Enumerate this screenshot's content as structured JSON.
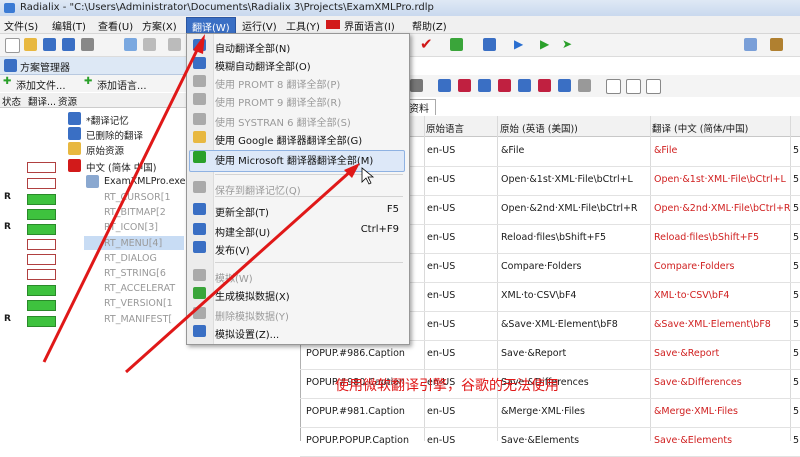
{
  "window": {
    "title": "Radialix - \"C:\\Users\\Administrator\\Documents\\Radialix 3\\Projects\\ExamXMLPro.rdlp"
  },
  "menubar": [
    {
      "label": "文件(S)"
    },
    {
      "label": "编辑(T)"
    },
    {
      "label": "查看(U)"
    },
    {
      "label": "方案(X)"
    },
    {
      "label": "翻译(W)",
      "active": true
    },
    {
      "label": "运行(V)"
    },
    {
      "label": "工具(Y)"
    },
    {
      "label": "界面语言(I)"
    },
    {
      "label": "帮助(Z)"
    }
  ],
  "solution_manager": {
    "title": "方案管理器",
    "add_file": "添加文件...",
    "add_language": "添加语言...",
    "columns": [
      "状态",
      "翻译...",
      "资源"
    ],
    "tree": [
      {
        "text": "*翻译记忆",
        "indent": 1
      },
      {
        "text": "已删除的翻译",
        "indent": 1
      },
      {
        "text": "原始资源",
        "indent": 1
      },
      {
        "text": "中文 (简体 中国)",
        "indent": 1
      },
      {
        "text": "ExamXMLPro.exe (",
        "indent": 2
      },
      {
        "text": "RT_CURSOR[1",
        "indent": 3
      },
      {
        "text": "RT_BITMAP[2",
        "indent": 3
      },
      {
        "text": "RT_ICON[3]",
        "indent": 3
      },
      {
        "text": "RT_MENU[4]",
        "indent": 3
      },
      {
        "text": "RT_DIALOG",
        "indent": 3
      },
      {
        "text": "RT_STRING[6",
        "indent": 3
      },
      {
        "text": "RT_ACCELERAT",
        "indent": 3
      },
      {
        "text": "RT_VERSION[1",
        "indent": 3
      },
      {
        "text": "RT_MANIFEST[",
        "indent": 3
      }
    ],
    "status_rows": [
      {
        "mark": "",
        "color": "red"
      },
      {
        "mark": "",
        "color": "red"
      },
      {
        "mark": "R",
        "color": "green"
      },
      {
        "mark": "",
        "color": "green"
      },
      {
        "mark": "R",
        "color": "green"
      },
      {
        "mark": "",
        "color": "red"
      },
      {
        "mark": "",
        "color": "red"
      },
      {
        "mark": "",
        "color": "red"
      },
      {
        "mark": "",
        "color": "green"
      },
      {
        "mark": "",
        "color": "green"
      },
      {
        "mark": "R",
        "color": "green"
      }
    ]
  },
  "translate_menu": {
    "items": [
      {
        "label": "自动翻译全部(N)",
        "disabled": false,
        "icon": "auto-translate-icon"
      },
      {
        "label": "模糊自动翻译全部(O)",
        "disabled": false,
        "icon": "fuzzy-translate-icon"
      },
      {
        "label": "使用 PROMT 8 翻译全部(P)",
        "disabled": true,
        "icon": "promt8-icon"
      },
      {
        "label": "使用 PROMT 9 翻译全部(R)",
        "disabled": true,
        "icon": "promt9-icon"
      },
      {
        "label": "使用 SYSTRAN 6 翻译全部(S)",
        "disabled": true,
        "icon": "systran-icon"
      },
      {
        "label": "使用 Google 翻译器翻译全部(G)",
        "disabled": false,
        "icon": "google-icon"
      },
      {
        "label": "使用 Microsoft 翻译器翻译全部(M)",
        "disabled": false,
        "icon": "microsoft-icon",
        "highlighted": true
      },
      {
        "label": "保存到翻译记忆(Q)",
        "disabled": true,
        "icon": "save-memory-icon"
      },
      {
        "label": "更新全部(T)",
        "disabled": false,
        "shortcut": "F5",
        "icon": "update-icon"
      },
      {
        "label": "构建全部(U)",
        "disabled": false,
        "shortcut": "Ctrl+F9",
        "icon": "build-icon"
      },
      {
        "label": "发布(V)",
        "disabled": false,
        "icon": "publish-icon"
      },
      {
        "label": "模拟(W)",
        "disabled": true,
        "icon": "simulate-icon"
      },
      {
        "label": "生成模拟数据(X)",
        "disabled": false,
        "icon": "gen-data-icon"
      },
      {
        "label": "删除模拟数据(Y)",
        "disabled": true,
        "icon": "delete-data-icon"
      },
      {
        "label": "模拟设置(Z)...",
        "disabled": false,
        "icon": "sim-settings-icon"
      }
    ]
  },
  "grid": {
    "tab_label": "针资料",
    "headers": [
      "原始语言",
      "原始 (英语 (美国))",
      "翻译 (中文 (简体/中国)"
    ],
    "rows": [
      {
        "id": "",
        "lang": "en-US",
        "source": "&File",
        "target": "&File"
      },
      {
        "id": "",
        "lang": "en-US",
        "source": "Open·&1st·XML·File\\bCtrl+L",
        "target": "Open·&1st·XML·File\\bCtrl+L"
      },
      {
        "id": "",
        "lang": "en-US",
        "source": "Open·&2nd·XML·File\\bCtrl+R",
        "target": "Open·&2nd·XML·File\\bCtrl+R"
      },
      {
        "id": "",
        "lang": "en-US",
        "source": "Reload·files\\bShift+F5",
        "target": "Reload·files\\bShift+F5"
      },
      {
        "id": "",
        "lang": "en-US",
        "source": "Compare·Folders",
        "target": "Compare·Folders"
      },
      {
        "id": "",
        "lang": "en-US",
        "source": "XML·to·CSV\\bF4",
        "target": "XML·to·CSV\\bF4"
      },
      {
        "id": "",
        "lang": "en-US",
        "source": "&Save·XML·Element\\bF8",
        "target": "&Save·XML·Element\\bF8"
      },
      {
        "id": "POPUP.#986.Caption",
        "lang": "en-US",
        "source": "Save·&Report",
        "target": "Save·&Report"
      },
      {
        "id": "POPUP.#980.Caption",
        "lang": "en-US",
        "source": "Save·&Differences",
        "target": "Save·&Differences"
      },
      {
        "id": "POPUP.#981.Caption",
        "lang": "en-US",
        "source": "&Merge·XML·Files",
        "target": "&Merge·XML·Files"
      },
      {
        "id": "POPUP.POPUP.Caption",
        "lang": "en-US",
        "source": "Save·&Elements",
        "target": "Save·&Elements"
      }
    ],
    "last_col_fragment": [
      "5",
      "5",
      "5",
      "5",
      "5",
      "5",
      "5",
      "5",
      "5",
      "5",
      "5"
    ]
  },
  "annotation": "使用微软翻译引擎，谷歌的无法使用",
  "colors": {
    "accent": "#3a6fc4",
    "annotation": "#e01818",
    "target_text": "#d02020"
  }
}
